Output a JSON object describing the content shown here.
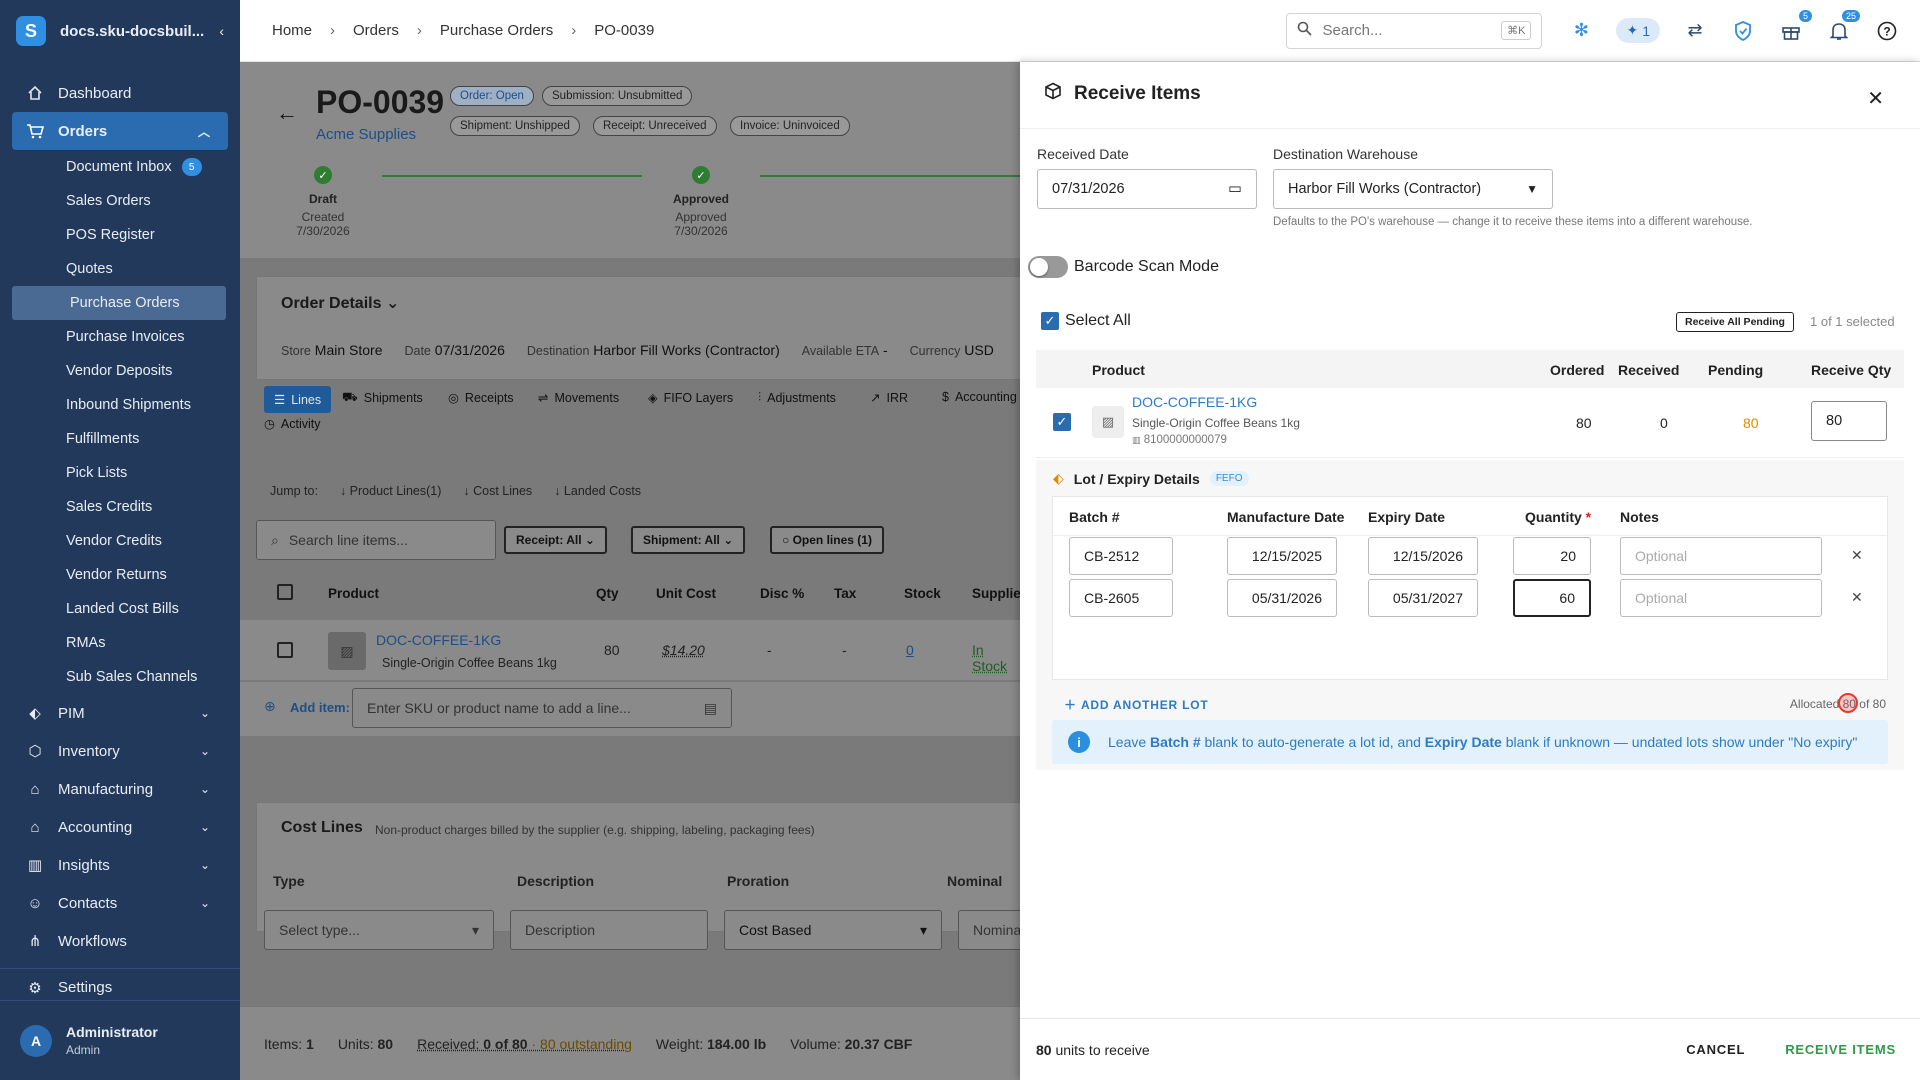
{
  "app": {
    "title": "docs.sku-docsbuil...",
    "logo_letter": "S"
  },
  "sidebar": {
    "items": [
      {
        "label": "Dashboard",
        "icon": "home-icon"
      },
      {
        "label": "Orders",
        "icon": "cart-icon"
      },
      {
        "label": "PIM",
        "icon": "tag-icon"
      },
      {
        "label": "Inventory",
        "icon": "box-icon"
      },
      {
        "label": "Manufacturing",
        "icon": "factory-icon"
      },
      {
        "label": "Accounting",
        "icon": "bank-icon"
      },
      {
        "label": "Insights",
        "icon": "chart-icon"
      },
      {
        "label": "Contacts",
        "icon": "contacts-icon"
      },
      {
        "label": "Workflows",
        "icon": "workflow-icon"
      },
      {
        "label": "Settings",
        "icon": "gear-icon"
      }
    ],
    "order_subitems": [
      "Document Inbox",
      "Sales Orders",
      "POS Register",
      "Quotes",
      "Purchase Orders",
      "Purchase Invoices",
      "Vendor Deposits",
      "Inbound Shipments",
      "Fulfillments",
      "Pick Lists",
      "Sales Credits",
      "Vendor Credits",
      "Vendor Returns",
      "Landed Cost Bills",
      "RMAs",
      "Sub Sales Channels"
    ],
    "inbox_badge": "5",
    "user": {
      "name": "Administrator",
      "role": "Admin",
      "initial": "A"
    }
  },
  "topbar": {
    "breadcrumbs": [
      "Home",
      "Orders",
      "Purchase Orders",
      "PO-0039"
    ],
    "search_placeholder": "Search...",
    "search_shortcut": "⌘K",
    "ai_count": "1",
    "gift_badge": "5",
    "bell_badge": "25"
  },
  "po": {
    "number": "PO-0039",
    "vendor": "Acme Supplies",
    "pills": [
      "Order: Open",
      "Submission: Unsubmitted",
      "Shipment: Unshipped",
      "Receipt: Unreceived",
      "Invoice: Uninvoiced"
    ],
    "steps": [
      {
        "name": "Draft",
        "sub": "Created",
        "date": "7/30/2026"
      },
      {
        "name": "Approved",
        "sub": "Approved",
        "date": "7/30/2026"
      }
    ],
    "order_details_title": "Order Details",
    "details": {
      "store_label": "Store",
      "store": "Main Store",
      "date_label": "Date",
      "date": "07/31/2026",
      "dest_label": "Destination",
      "dest": "Harbor Fill Works (Contractor)",
      "eta_label": "Available ETA",
      "eta": "-",
      "currency_label": "Currency",
      "currency": "USD"
    },
    "tabs": [
      "Lines",
      "Shipments",
      "Receipts",
      "Movements",
      "FIFO Layers",
      "Adjustments",
      "IRR",
      "Accounting",
      "Activity"
    ],
    "jump_label": "Jump to:",
    "jumps": [
      "Product Lines(1)",
      "Cost Lines",
      "Landed Costs"
    ],
    "line_search_placeholder": "Search line items...",
    "filters": [
      "Receipt: All",
      "Shipment: All",
      "Open lines (1)"
    ],
    "line_headers": [
      "Product",
      "Qty",
      "Unit Cost",
      "Disc %",
      "Tax",
      "Stock",
      "Supplie"
    ],
    "line": {
      "sku": "DOC-COFFEE-1KG",
      "name": "Single-Origin Coffee Beans 1kg",
      "qty": "80",
      "unit_cost": "$14.20",
      "disc": "-",
      "tax": "-",
      "stock": "0",
      "supplier": "In Stock"
    },
    "add_item_label": "Add item:",
    "add_item_placeholder": "Enter SKU or product name to add a line...",
    "cost_lines": {
      "title": "Cost Lines",
      "desc": "Non-product charges billed by the supplier (e.g. shipping, labeling, packaging fees)",
      "headers": [
        "Type",
        "Description",
        "Proration",
        "Nominal"
      ],
      "type_placeholder": "Select type...",
      "desc_placeholder": "Description",
      "proration": "Cost Based",
      "nominal_placeholder": "Nomina"
    },
    "footer": {
      "items_label": "Items:",
      "items": "1",
      "units_label": "Units:",
      "units": "80",
      "received_label": "Received:",
      "received": "0 of 80",
      "outstanding": "· 80 outstanding",
      "weight_label": "Weight:",
      "weight": "184.00 lb",
      "volume_label": "Volume:",
      "volume": "20.37 CBF"
    }
  },
  "receive": {
    "title": "Receive Items",
    "received_date_label": "Received Date",
    "received_date": "07/31/2026",
    "warehouse_label": "Destination Warehouse",
    "warehouse": "Harbor Fill Works (Contractor)",
    "warehouse_hint": "Defaults to the PO's warehouse — change it to receive these items into a different warehouse.",
    "barcode_label": "Barcode Scan Mode",
    "select_all": "Select All",
    "receive_all_pending": "Receive All Pending",
    "selected_count": "1 of 1 selected",
    "headers": [
      "Product",
      "Ordered",
      "Received",
      "Pending",
      "Receive Qty"
    ],
    "item": {
      "sku": "DOC-COFFEE-1KG",
      "name": "Single-Origin Coffee Beans 1kg",
      "barcode": "8100000000079",
      "ordered": "80",
      "received": "0",
      "pending": "80",
      "receive_qty": "80"
    },
    "lot_title": "Lot / Expiry Details",
    "lot_badge": "FEFO",
    "lot_headers": [
      "Batch #",
      "Manufacture Date",
      "Expiry Date",
      "Quantity",
      "Notes"
    ],
    "lots": [
      {
        "batch": "CB-2512",
        "mfg": "12/15/2025",
        "exp": "12/15/2026",
        "qty": "20",
        "notes_placeholder": "Optional"
      },
      {
        "batch": "CB-2605",
        "mfg": "05/31/2026",
        "exp": "05/31/2027",
        "qty": "60",
        "notes_placeholder": "Optional"
      }
    ],
    "add_lot": "ADD ANOTHER LOT",
    "allocated": "Allocated 80 of 80",
    "info_parts": [
      "Leave ",
      "Batch #",
      " blank to auto-generate a lot id, and ",
      "Expiry Date",
      " blank if unknown — undated lots show under \"No expiry\""
    ],
    "footer_units": "80",
    "footer_units_label": " units to receive",
    "cancel": "CANCEL",
    "receive_items": "RECEIVE ITEMS"
  },
  "colors": {
    "sidebar": "#22395b",
    "accent": "#2b6cb0",
    "pending": "#e08a00",
    "success": "#2e7d32",
    "receive_btn": "#2e9a4a"
  }
}
